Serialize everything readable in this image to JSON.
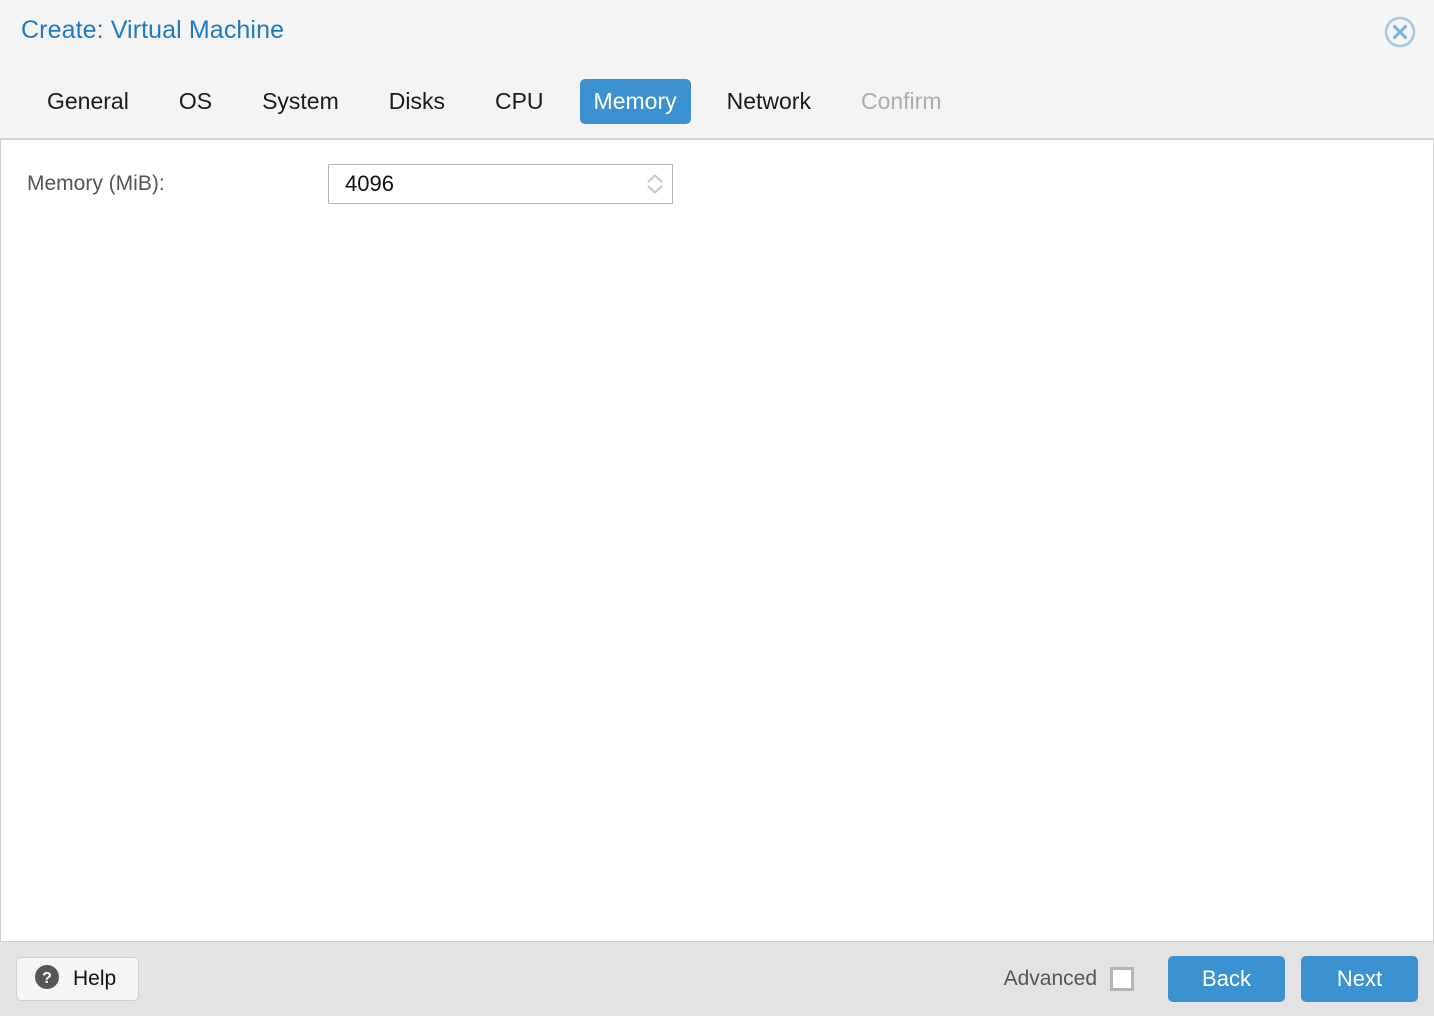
{
  "window": {
    "title": "Create: Virtual Machine",
    "close_icon": "close-circle-icon"
  },
  "tabs": [
    {
      "label": "General",
      "state": "normal"
    },
    {
      "label": "OS",
      "state": "normal"
    },
    {
      "label": "System",
      "state": "normal"
    },
    {
      "label": "Disks",
      "state": "normal"
    },
    {
      "label": "CPU",
      "state": "normal"
    },
    {
      "label": "Memory",
      "state": "active"
    },
    {
      "label": "Network",
      "state": "normal"
    },
    {
      "label": "Confirm",
      "state": "disabled"
    }
  ],
  "form": {
    "memory": {
      "label": "Memory (MiB):",
      "value": "4096",
      "placeholder": "",
      "spinner_up_icon": "chevron-up-icon",
      "spinner_down_icon": "chevron-down-icon"
    }
  },
  "footer": {
    "help_label": "Help",
    "help_icon": "question-circle-icon",
    "advanced_label": "Advanced",
    "advanced_checked": false,
    "back_label": "Back",
    "next_label": "Next"
  },
  "colors": {
    "accent": "#3c92d0",
    "title": "#1f7ac4",
    "header_bg": "#f4f4f4",
    "footer_bg": "#e3e3e3",
    "content_bg": "#ffffff",
    "label_text": "#555555",
    "disabled_text": "#adadad"
  }
}
